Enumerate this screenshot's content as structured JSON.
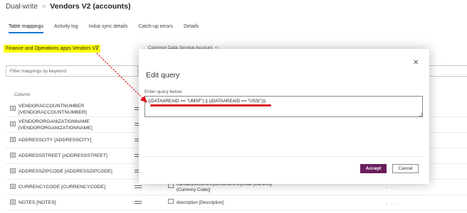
{
  "breadcrumb": {
    "parent": "Dual-write",
    "separator": ">",
    "current": "Vendors V2 (accounts)"
  },
  "tabs": [
    "Table mappings",
    "Activity log",
    "Initial sync details",
    "Catch-up errors",
    "Details"
  ],
  "source_entity": {
    "label": "Finance and Operations apps Vendors V2",
    "chevron": "▽"
  },
  "target_entity": {
    "label": "Common Data Service Account",
    "chevron": "▽"
  },
  "filter": {
    "placeholder": "Filter mappings by keyword",
    "value": ""
  },
  "columns": {
    "source_header": "Column"
  },
  "rows": [
    {
      "source": [
        "VENDORACCOUNTNUMBER",
        "[VENDORACCOUNTNUMBER]"
      ],
      "target": [],
      "more": ""
    },
    {
      "source": [
        "VENDORORGANIZATIONNAME",
        "[VENDORORGANIZATIONNAME]"
      ],
      "target": [],
      "more": ""
    },
    {
      "source": [
        "ADDRESSCITY [ADDRESSCITY]"
      ],
      "target": [],
      "more": ""
    },
    {
      "source": [
        "ADDRESSSTREET [ADDRESSSTREET]"
      ],
      "target": [],
      "more": ""
    },
    {
      "source": [
        "ADDRESSZIPCODE [ADDRESSZIPCODE]"
      ],
      "target": [],
      "more": ""
    },
    {
      "source": [
        "CURRENCYCODE [CURRENCYCODE]"
      ],
      "target": [
        "transactioncurrencyid.isocurrencycode [Currency",
        "(Currency Code)]"
      ],
      "more": "· · ·"
    },
    {
      "source": [
        "NOTES [NOTES]"
      ],
      "target": [
        "description [Description]"
      ],
      "more": "· · ·"
    }
  ],
  "modal": {
    "close_icon": "✕",
    "title": "Edit query",
    "field_label": "Enter query below",
    "query": "((DATAAREAID == \"UMSF\") || ((DATAAREAID == \"USSI\")))",
    "accept_label": "Accept",
    "cancel_label": "Cancel"
  },
  "colors": {
    "accent": "#0078d4",
    "accept": "#6b1e5c",
    "highlight": "#ffff00",
    "annotation": "#d9141c"
  }
}
